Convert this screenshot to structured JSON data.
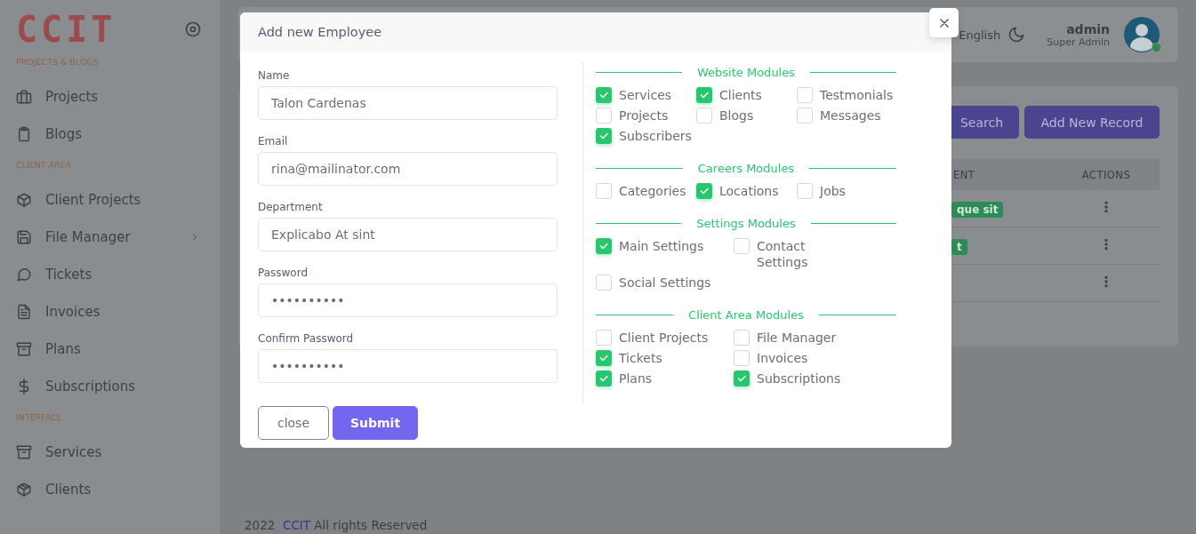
{
  "sidebar": {
    "logo": "CCIT",
    "sections": [
      {
        "title": "PROJECTS & BLOGS",
        "items": [
          {
            "label": "Projects",
            "expandable": false
          },
          {
            "label": "Blogs",
            "expandable": false
          }
        ]
      },
      {
        "title": "CLIENT AREA",
        "items": [
          {
            "label": "Client Projects",
            "expandable": false
          },
          {
            "label": "File Manager",
            "expandable": true
          },
          {
            "label": "Tickets",
            "expandable": false
          },
          {
            "label": "Invoices",
            "expandable": false
          },
          {
            "label": "Plans",
            "expandable": false
          },
          {
            "label": "Subscriptions",
            "expandable": false
          }
        ]
      },
      {
        "title": "INTERFACE",
        "items": [
          {
            "label": "Services",
            "expandable": false
          },
          {
            "label": "Clients",
            "expandable": false
          }
        ]
      }
    ]
  },
  "header": {
    "language": "English",
    "user": {
      "name": "admin",
      "role": "Super Admin",
      "online": true
    }
  },
  "records": {
    "buttons": [
      "Search",
      "Add New Record"
    ],
    "table": {
      "columns": [
        "ENT",
        "ACTIONS"
      ],
      "rows": [
        {
          "badge": "que sit"
        },
        {
          "badge": "t"
        },
        {}
      ]
    }
  },
  "modal": {
    "title": "Add new Employee",
    "fields": [
      {
        "label": "Name",
        "value": "Talon Cardenas"
      },
      {
        "label": "Email",
        "value": "rina@mailinator.com"
      },
      {
        "label": "Department",
        "value": "Explicabo At sint"
      },
      {
        "label": "Password",
        "value": "••••••••••"
      },
      {
        "label": "Confirm Password",
        "value": "••••••••••"
      }
    ],
    "module_groups": [
      {
        "title": "Website Modules",
        "kind": "three-column",
        "modules": [
          {
            "label": "Services",
            "checked": true
          },
          {
            "label": "Clients",
            "checked": true
          },
          {
            "label": "Testmonials",
            "checked": false
          },
          {
            "label": "Projects",
            "checked": false
          },
          {
            "label": "Blogs",
            "checked": false
          },
          {
            "label": "Messages",
            "checked": false
          },
          {
            "label": "Subscribers",
            "checked": true
          }
        ]
      },
      {
        "title": "Careers Modules",
        "kind": "three-column",
        "modules": [
          {
            "label": "Categories",
            "checked": false
          },
          {
            "label": "Locations",
            "checked": true
          },
          {
            "label": "Jobs",
            "checked": false
          }
        ]
      },
      {
        "title": "Settings Modules",
        "kind": "two-column-narrow",
        "modules": [
          {
            "label": "Main Settings",
            "checked": true
          },
          {
            "label": "Contact Settings",
            "checked": false
          },
          {
            "label": "Social Settings",
            "checked": false
          }
        ]
      },
      {
        "title": "Client Area Modules",
        "kind": "two-column",
        "modules": [
          {
            "label": "Client Projects",
            "checked": false
          },
          {
            "label": "File Manager",
            "checked": false
          },
          {
            "label": "Tickets",
            "checked": true
          },
          {
            "label": "Invoices",
            "checked": false
          },
          {
            "label": "Plans",
            "checked": true
          },
          {
            "label": "Subscriptions",
            "checked": true
          }
        ]
      }
    ],
    "buttons": [
      {
        "label": "close",
        "kind": "secondary"
      },
      {
        "label": "Submit",
        "kind": "primary"
      }
    ]
  },
  "footer": {
    "year": "2022",
    "brand": "CCIT",
    "text": "All rights Reserved"
  }
}
